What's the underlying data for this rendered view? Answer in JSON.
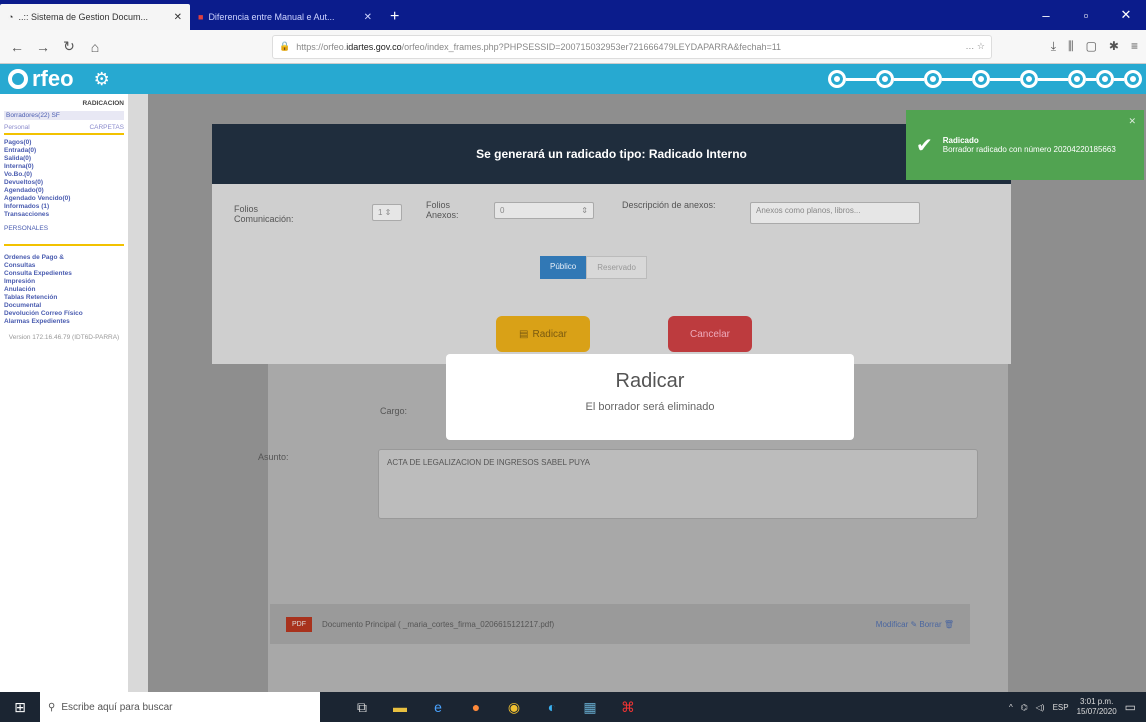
{
  "browser": {
    "tabs": [
      {
        "title": "..:: Sistema de Gestion Docum...",
        "active": true
      },
      {
        "title": "Diferencia entre Manual e Aut...",
        "active": false
      }
    ],
    "url_prefix": "https://orfeo.",
    "url_domain": "idartes.gov.co",
    "url_rest": "/orfeo/index_frames.php?PHPSESSID=200715032953er721666479LEYDAPARRA&fechah=11"
  },
  "app": {
    "logo_text": "rfeo"
  },
  "sidebar": {
    "section_radicacion": "RADICACION",
    "borradores": "Borradores(22) SF",
    "carpetas_left": "Personal",
    "carpetas_right": "CARPETAS",
    "items": [
      "Pagos(0)",
      "Entrada(0)",
      "Salida(0)",
      "Interna(0)",
      "Vo.Bo.(0)",
      "Devueltos(0)",
      "Agendado(0)",
      "Agendado Vencido(0)",
      "Informados (1)",
      "Transacciones"
    ],
    "personales": "PERSONALES",
    "links": [
      "Ordenes de Pago &",
      "Consultas",
      "Consulta Expedientes",
      "Impresión",
      "Anulación",
      "Tablas Retención",
      "Documental",
      "Devolución Correo Físico",
      "Alarmas Expedientes"
    ],
    "version": "Version 172.16.46.79 (IDT6D-PARRA)"
  },
  "background": {
    "cargo_label": "Cargo:",
    "asunto_label": "Asunto:",
    "asunto_value": "ACTA DE LEGALIZACION DE INGRESOS SABEL PUYA",
    "doc_badge": "PDF",
    "doc_text": "Documento Principal ( _maria_cortes_firma_0206615121217.pdf)",
    "doc_links": "Modificar ✎  Borrar 🗑"
  },
  "modal": {
    "title": "Se generará un radicado tipo: Radicado Interno",
    "folios_com_label": "Folios Comunicación:",
    "folios_com_value": "1",
    "folios_anexos_label": "Folios Anexos:",
    "folios_anexos_value": "0",
    "descripcion_label": "Descripción de anexos:",
    "descripcion_placeholder": "Anexos como planos, libros...",
    "seg_publico": "Público",
    "seg_reservado": "Reservado",
    "radicar_label": "Radicar",
    "cancelar_label": "Cancelar"
  },
  "alert": {
    "title": "Radicar",
    "message": "El borrador será eliminado"
  },
  "toast": {
    "title": "Radicado",
    "message": "Borrador radicado con número 20204220185663"
  },
  "taskbar": {
    "search_placeholder": "Escribe aquí para buscar",
    "lang": "ESP",
    "time": "3:01 p.m.",
    "date": "15/07/2020"
  },
  "colors": {
    "header": "#27a9d1",
    "toast": "#51a351",
    "radicar": "#d9a117",
    "cancelar": "#bd3b3e"
  }
}
